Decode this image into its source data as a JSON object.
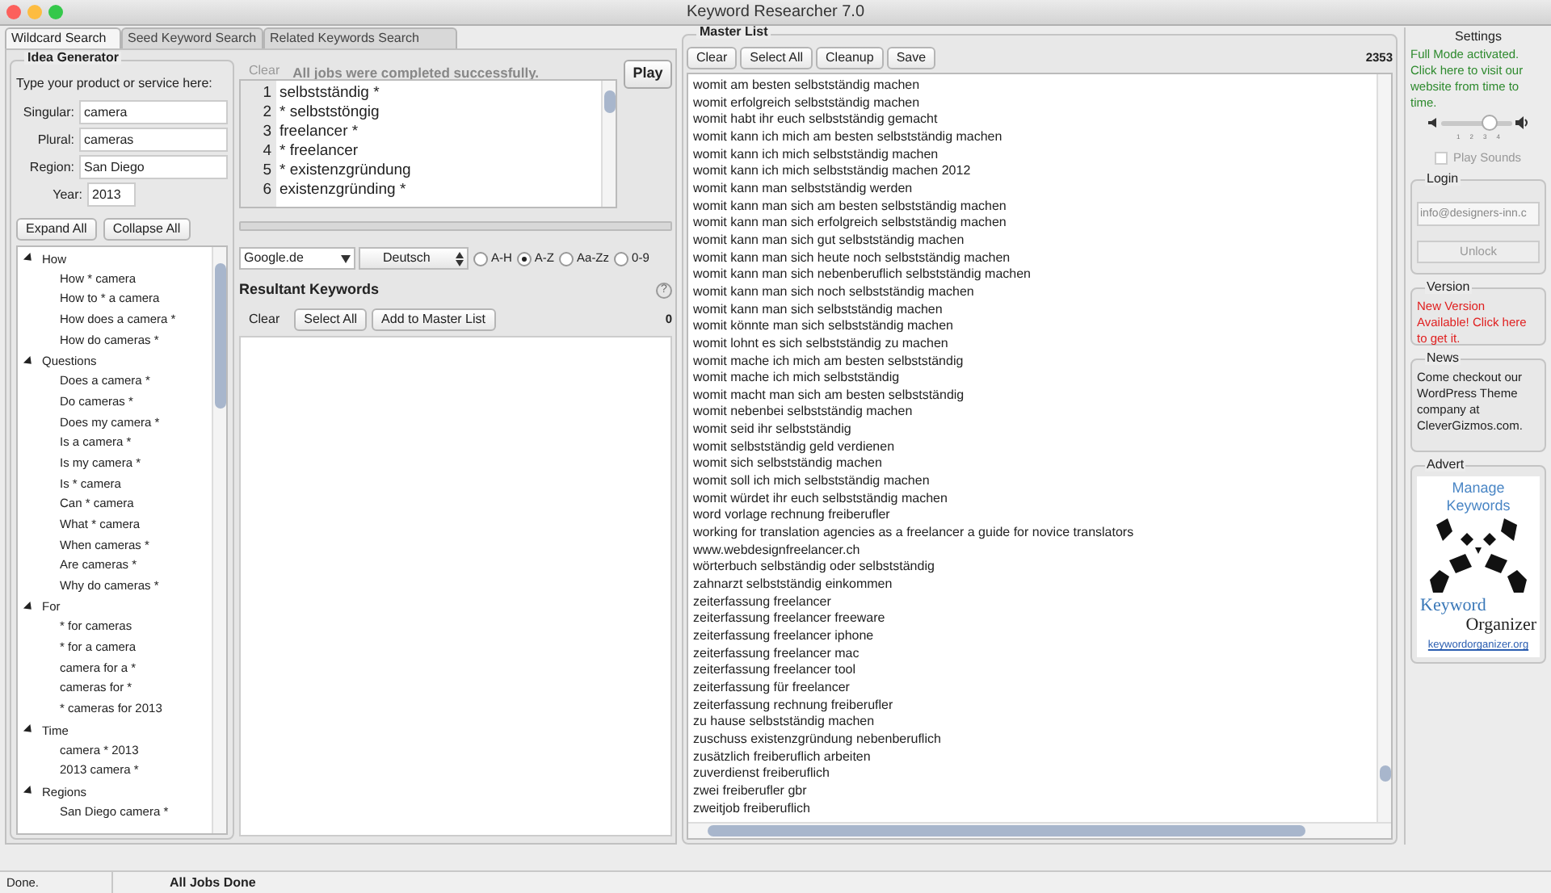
{
  "window": {
    "title": "Keyword Researcher 7.0"
  },
  "tabs": [
    {
      "label": "Wildcard Search",
      "selected": true
    },
    {
      "label": "Seed Keyword Search",
      "selected": false
    },
    {
      "label": "Related Keywords Search",
      "selected": false
    }
  ],
  "idea_generator": {
    "title": "Idea Generator",
    "prompt": "Type your product or service here:",
    "fields": [
      {
        "label": "Singular:",
        "value": "camera"
      },
      {
        "label": "Plural:",
        "value": "cameras"
      },
      {
        "label": "Region:",
        "value": "San Diego"
      },
      {
        "label": "Year:",
        "value": "2013"
      }
    ],
    "buttons": [
      "Expand All",
      "Collapse All"
    ],
    "tree": [
      {
        "label": "How",
        "expanded": true,
        "children": [
          {
            "label": "How * camera"
          },
          {
            "label": "How to * a camera"
          },
          {
            "label": "How does a camera *"
          },
          {
            "label": "How do cameras *"
          }
        ]
      },
      {
        "label": "Questions",
        "expanded": true,
        "children": [
          {
            "label": "Does a camera *"
          },
          {
            "label": "Do cameras *"
          },
          {
            "label": "Does my camera *"
          },
          {
            "label": "Is a camera *"
          },
          {
            "label": "Is my camera *"
          },
          {
            "label": "Is * camera"
          },
          {
            "label": "Can * camera"
          },
          {
            "label": "What * camera"
          },
          {
            "label": "When cameras *"
          },
          {
            "label": "Are cameras *"
          },
          {
            "label": "Why do cameras *"
          }
        ]
      },
      {
        "label": "For",
        "expanded": true,
        "children": [
          {
            "label": "* for cameras"
          },
          {
            "label": "* for a camera"
          },
          {
            "label": "camera for a *"
          },
          {
            "label": "cameras for *"
          },
          {
            "label": "* cameras for 2013"
          }
        ]
      },
      {
        "label": "Time",
        "expanded": true,
        "children": [
          {
            "label": "camera * 2013"
          },
          {
            "label": "2013 camera *"
          }
        ]
      },
      {
        "label": "Regions",
        "expanded": true,
        "children": [
          {
            "label": "San Diego camera *"
          }
        ]
      }
    ]
  },
  "seed_editor": {
    "clear": "Clear",
    "status": "All jobs were completed successfully.",
    "play": "Play",
    "lines": [
      {
        "number": "1",
        "text": "selbstständig *"
      },
      {
        "number": "2",
        "text": "* selbststöngig"
      },
      {
        "number": "3",
        "text": "freelancer *"
      },
      {
        "number": "4",
        "text": "* freelancer"
      },
      {
        "number": "5",
        "text": "* existenzgründung"
      },
      {
        "number": "6",
        "text": "existenzgründing *"
      }
    ],
    "progress": {
      "level": 0
    }
  },
  "options": {
    "engine": "Google.de",
    "language": "Deutsch",
    "sort": [
      {
        "label": "A-H",
        "selected": false
      },
      {
        "label": "A-Z",
        "selected": true
      },
      {
        "label": "Aa-Zz",
        "selected": false
      },
      {
        "label": "0-9",
        "selected": false
      }
    ]
  },
  "resultant": {
    "title": "Resultant Keywords",
    "help": "?",
    "buttons": [
      "Clear",
      "Select All",
      "Add to Master List"
    ],
    "count": "0"
  },
  "master_list": {
    "title": "Master List",
    "buttons": [
      "Clear",
      "Select All",
      "Cleanup",
      "Save"
    ],
    "count": "2353",
    "rows": [
      "womit am besten selbstständig machen",
      "womit erfolgreich selbstständig machen",
      "womit habt ihr euch selbstständig gemacht",
      "womit kann ich mich am besten selbstständig machen",
      "womit kann ich mich selbstständig machen",
      "womit kann ich mich selbstständig machen 2012",
      "womit kann man selbstständig werden",
      "womit kann man sich am besten selbstständig machen",
      "womit kann man sich erfolgreich selbstständig machen",
      "womit kann man sich gut selbstständig machen",
      "womit kann man sich heute noch selbstständig machen",
      "womit kann man sich nebenberuflich selbstständig machen",
      "womit kann man sich noch selbstständig machen",
      "womit kann man sich selbstständig machen",
      "womit könnte man sich selbstständig machen",
      "womit lohnt es sich selbstständig zu machen",
      "womit mache ich mich am besten selbstständig",
      "womit mache ich mich selbstständig",
      "womit macht man sich am besten selbstständig",
      "womit nebenbei selbstständig machen",
      "womit seid ihr selbstständig",
      "womit selbstständig geld verdienen",
      "womit sich selbstständig machen",
      "womit soll ich mich selbstständig machen",
      "womit würdet ihr euch selbstständig machen",
      "word vorlage rechnung freiberufler",
      "working for translation agencies as a freelancer a guide for novice translators",
      "www.webdesignfreelancer.ch",
      "wörterbuch selbständig oder selbstständig",
      "zahnarzt selbstständig einkommen",
      "zeiterfassung freelancer",
      "zeiterfassung freelancer freeware",
      "zeiterfassung freelancer iphone",
      "zeiterfassung freelancer mac",
      "zeiterfassung freelancer tool",
      "zeiterfassung für freelancer",
      "zeiterfassung rechnung freiberufler",
      "zu hause selbstständig machen",
      "zuschuss existenzgründung nebenberuflich",
      "zusätzlich freiberuflich arbeiten",
      "zuverdienst freiberuflich",
      "zwei freiberufler gbr",
      "zweitjob freiberuflich"
    ]
  },
  "sidebar": {
    "settings": {
      "title": "Settings",
      "message": "Full Mode activated. Click here to visit our website from time to time.",
      "volume": {
        "level": 0.7,
        "ticks": [
          "1",
          "2",
          "3",
          "4"
        ]
      },
      "play_sounds": {
        "label": "Play Sounds",
        "checked": false
      }
    },
    "login": {
      "title": "Login",
      "email": "info@designers-inn.c",
      "button": "Unlock"
    },
    "version": {
      "title": "Version",
      "message": "New Version Available! Click here to get it."
    },
    "news": {
      "title": "News",
      "message": "Come checkout our WordPress Theme company at CleverGizmos.com."
    },
    "advert": {
      "title": "Advert",
      "lines": [
        "Manage",
        "Keywords"
      ],
      "brand": [
        "Keyword",
        "Organizer"
      ],
      "link": "keywordorganizer.org"
    }
  },
  "status_bar": {
    "left": "Done.",
    "message": "All Jobs Done"
  }
}
